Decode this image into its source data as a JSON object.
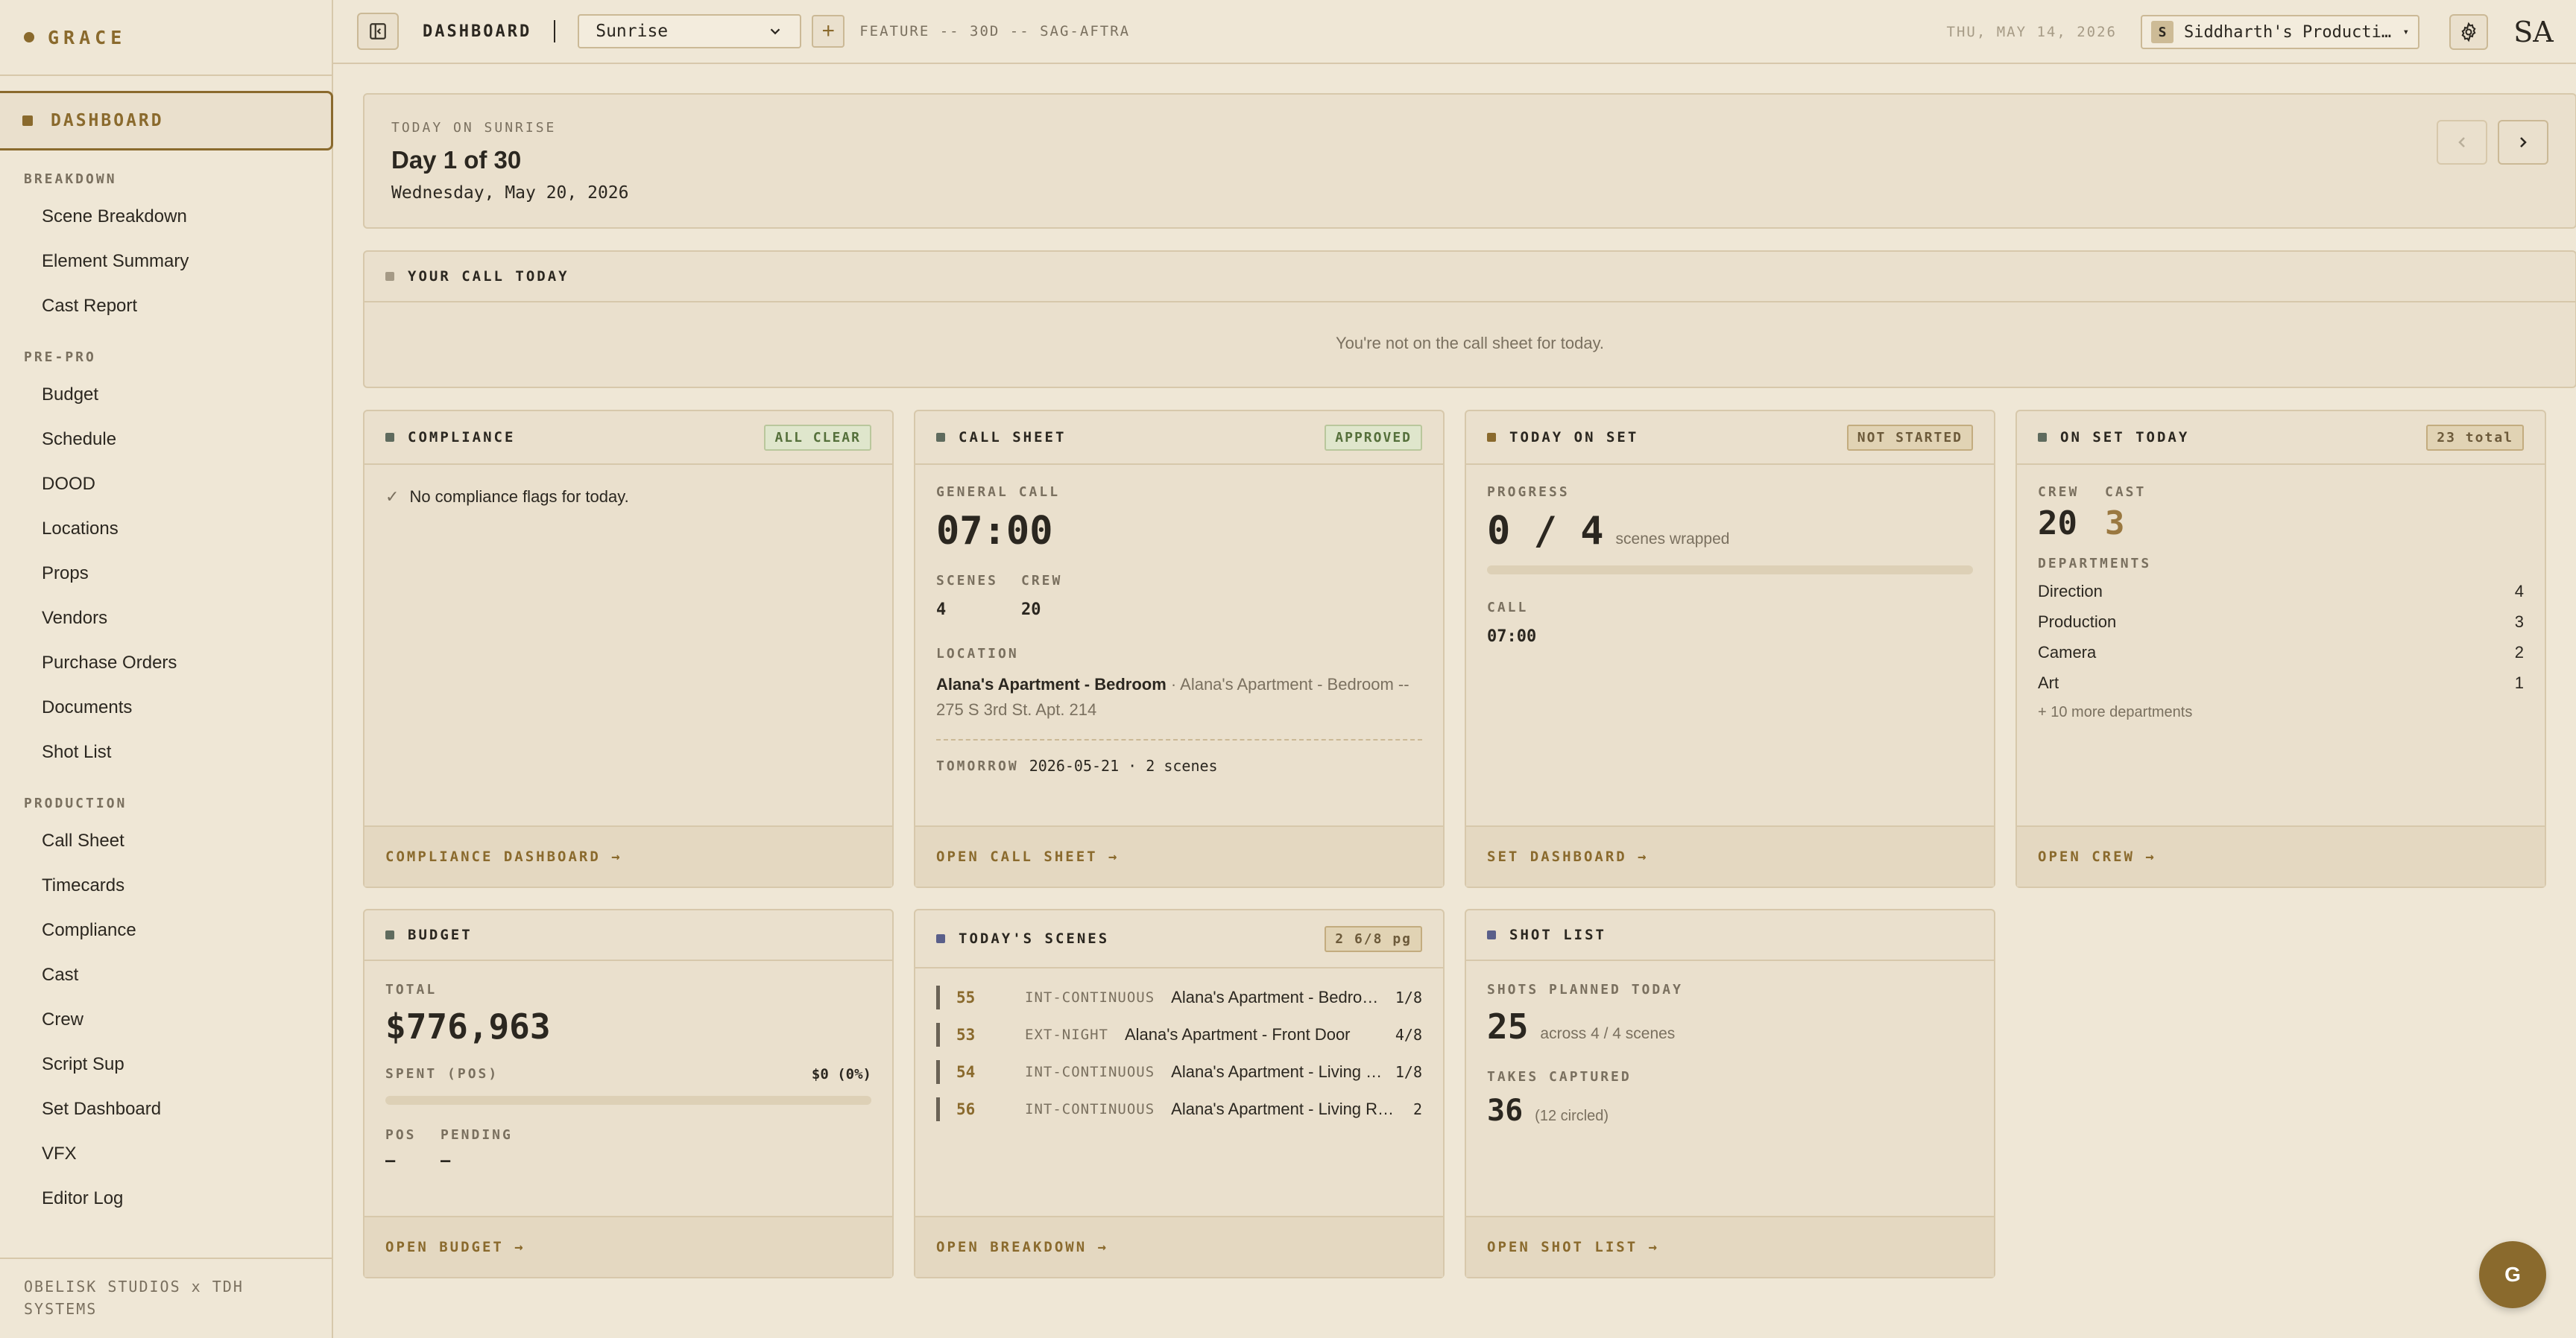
{
  "app": {
    "brand": "GRACE"
  },
  "sidebar": {
    "dashboard": "DASHBOARD",
    "sections": [
      {
        "title": "BREAKDOWN",
        "items": [
          "Scene Breakdown",
          "Element Summary",
          "Cast Report"
        ]
      },
      {
        "title": "PRE-PRO",
        "items": [
          "Budget",
          "Schedule",
          "DOOD",
          "Locations",
          "Props",
          "Vendors",
          "Purchase Orders",
          "Documents",
          "Shot List"
        ]
      },
      {
        "title": "PRODUCTION",
        "items": [
          "Call Sheet",
          "Timecards",
          "Compliance",
          "Cast",
          "Crew",
          "Script Sup",
          "Set Dashboard",
          "VFX",
          "Editor Log"
        ]
      }
    ],
    "footer": "OBELISK STUDIOS x TDH SYSTEMS"
  },
  "topbar": {
    "title": "DASHBOARD",
    "project": "Sunrise",
    "project_meta": "FEATURE -- 30D -- SAG-AFTRA",
    "date": "THU, MAY 14, 2026",
    "org_badge": "S",
    "org_name": "Siddharth's Producti…",
    "avatar": "SA"
  },
  "today": {
    "label": "TODAY ON SUNRISE",
    "day": "Day 1 of 30",
    "date": "Wednesday, May 20, 2026"
  },
  "your_call": {
    "title": "YOUR CALL TODAY",
    "message": "You're not on the call sheet for today."
  },
  "compliance": {
    "title": "COMPLIANCE",
    "status": "ALL CLEAR",
    "message": "No compliance flags for today.",
    "footer": "COMPLIANCE DASHBOARD →"
  },
  "call_sheet": {
    "title": "CALL SHEET",
    "status": "APPROVED",
    "general_call_label": "GENERAL CALL",
    "general_call": "07:00",
    "scenes_label": "SCENES",
    "scenes": "4",
    "crew_label": "CREW",
    "crew": "20",
    "location_label": "LOCATION",
    "location_name": "Alana's Apartment - Bedroom",
    "location_detail": "Alana's Apartment - Bedroom -- 275 S 3rd St. Apt. 214",
    "tomorrow_label": "TOMORROW",
    "tomorrow_value": "2026-05-21 · 2 scenes",
    "footer": "OPEN CALL SHEET →"
  },
  "today_on_set": {
    "title": "TODAY ON SET",
    "status": "NOT STARTED",
    "progress_label": "PROGRESS",
    "progress_value": "0 / 4",
    "progress_unit": "scenes wrapped",
    "progress_fraction": 0,
    "call_label": "CALL",
    "call_value": "07:00",
    "footer": "SET DASHBOARD →"
  },
  "on_set_today": {
    "title": "ON SET TODAY",
    "total": "23 total",
    "crew_label": "CREW",
    "crew": "20",
    "cast_label": "CAST",
    "cast": "3",
    "departments_label": "DEPARTMENTS",
    "departments": [
      {
        "name": "Direction",
        "count": "4"
      },
      {
        "name": "Production",
        "count": "3"
      },
      {
        "name": "Camera",
        "count": "2"
      },
      {
        "name": "Art",
        "count": "1"
      }
    ],
    "more": "+ 10 more departments",
    "footer": "OPEN CREW →"
  },
  "budget": {
    "title": "BUDGET",
    "total_label": "TOTAL",
    "total": "$776,963",
    "spent_label": "SPENT (POS)",
    "spent_value": "$0 (0%)",
    "spent_fraction": 0,
    "pos_label": "POS",
    "pos_value": "—",
    "pending_label": "PENDING",
    "pending_value": "—",
    "footer": "OPEN BUDGET →"
  },
  "todays_scenes": {
    "title": "TODAY'S SCENES",
    "badge": "2 6/8 pg",
    "rows": [
      {
        "no": "55",
        "type": "INT-CONTINUOUS",
        "name": "Alana's Apartment - Bedroom",
        "pages": "1/8"
      },
      {
        "no": "53",
        "type": "EXT-NIGHT",
        "name": "Alana's Apartment - Front Door",
        "pages": "4/8"
      },
      {
        "no": "54",
        "type": "INT-CONTINUOUS",
        "name": "Alana's Apartment - Living Room",
        "pages": "1/8"
      },
      {
        "no": "56",
        "type": "INT-CONTINUOUS",
        "name": "Alana's Apartment - Living Room",
        "pages": "2"
      }
    ],
    "footer": "OPEN BREAKDOWN →"
  },
  "shot_list": {
    "title": "SHOT LIST",
    "planned_label": "SHOTS PLANNED TODAY",
    "planned": "25",
    "planned_note": "across 4 / 4 scenes",
    "takes_label": "TAKES CAPTURED",
    "takes": "36",
    "takes_note": "(12 circled)",
    "footer": "OPEN SHOT LIST →"
  },
  "fab": "G",
  "colors": {
    "accent": "#8a6a2d",
    "background": "#efe7d6"
  }
}
